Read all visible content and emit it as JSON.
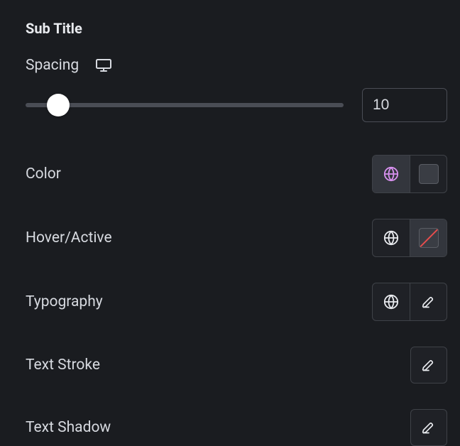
{
  "section_title": "Sub Title",
  "spacing": {
    "label": "Spacing",
    "value": "10"
  },
  "color": {
    "label": "Color"
  },
  "hover_active": {
    "label": "Hover/Active"
  },
  "typography": {
    "label": "Typography"
  },
  "text_stroke": {
    "label": "Text Stroke"
  },
  "text_shadow": {
    "label": "Text Shadow"
  }
}
